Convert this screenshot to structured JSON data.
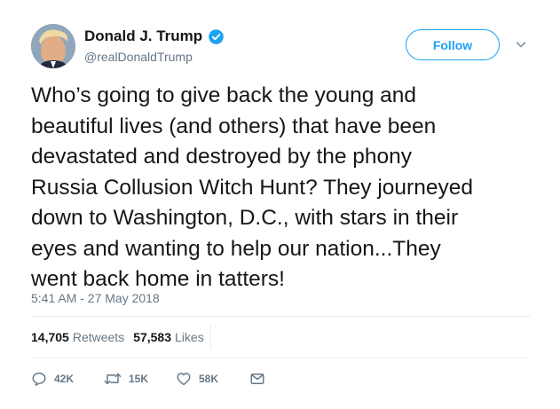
{
  "user": {
    "display_name": "Donald J. Trump",
    "handle": "@realDonaldTrump",
    "verified": true
  },
  "follow_button": {
    "label": "Follow"
  },
  "tweet": {
    "text": "Who’s going to give back the young and\nbeautiful lives (and others) that have been\ndevastated and destroyed by the phony\nRussia Collusion Witch Hunt? They journeyed\ndown to Washington, D.C., with stars in their\neyes and wanting to help our nation...They\nwent back home in tatters!",
    "timestamp": "5:41 AM - 27 May 2018"
  },
  "stats": {
    "retweets": {
      "value": "14,705",
      "label": "Retweets"
    },
    "likes": {
      "value": "57,583",
      "label": "Likes"
    }
  },
  "actions": {
    "reply_count": "42K",
    "retweet_count": "15K",
    "like_count": "58K"
  },
  "icons": {
    "verified": "verified-badge-icon",
    "caret": "chevron-down-icon",
    "reply": "reply-icon",
    "retweet": "retweet-icon",
    "like": "heart-icon",
    "message": "envelope-icon"
  },
  "colors": {
    "accent": "#1da1f2",
    "text": "#14171a",
    "secondary": "#657786",
    "divider": "#e6ecf0"
  }
}
